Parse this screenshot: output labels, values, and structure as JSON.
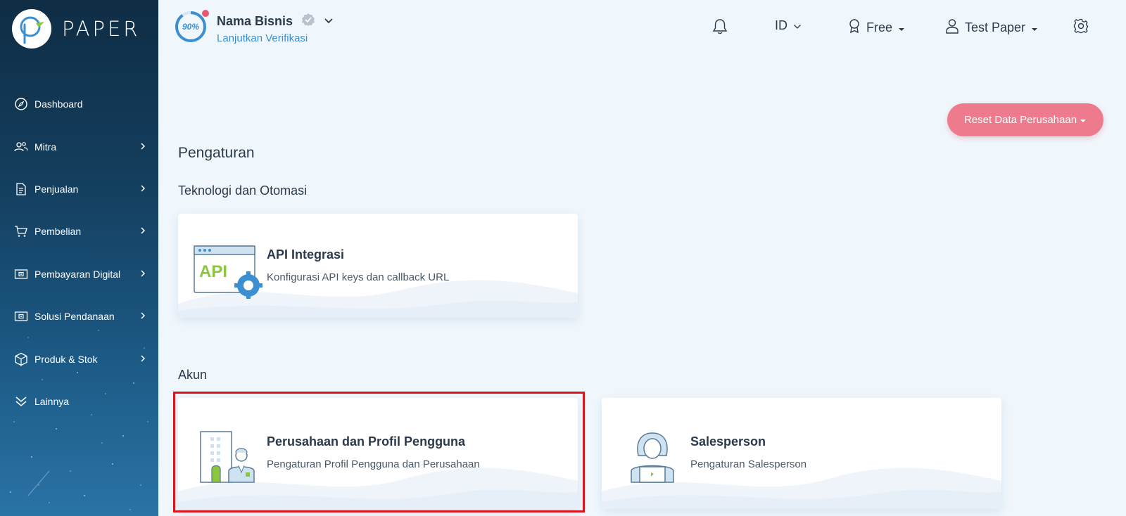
{
  "app": {
    "logo_text": "PAPER"
  },
  "sidebar": {
    "items": [
      {
        "label": "Dashboard",
        "icon": "compass-icon",
        "has_submenu": false
      },
      {
        "label": "Mitra",
        "icon": "users-icon",
        "has_submenu": true
      },
      {
        "label": "Penjualan",
        "icon": "document-icon",
        "has_submenu": true
      },
      {
        "label": "Pembelian",
        "icon": "cart-icon",
        "has_submenu": true
      },
      {
        "label": "Pembayaran Digital",
        "icon": "wallet-icon",
        "has_submenu": true
      },
      {
        "label": "Solusi Pendanaan",
        "icon": "wallet-icon",
        "has_submenu": true
      },
      {
        "label": "Produk & Stok",
        "icon": "box-icon",
        "has_submenu": true
      },
      {
        "label": "Lainnya",
        "icon": "double-chevron-down-icon",
        "has_submenu": false
      }
    ]
  },
  "header": {
    "progress": "90%",
    "progress_value": 0.9,
    "business_name": "Nama Bisnis",
    "verify_link": "Lanjutkan Verifikasi",
    "language": "ID",
    "plan": "Free",
    "user": "Test Paper"
  },
  "main": {
    "reset_button": "Reset Data Perusahaan",
    "page_title": "Pengaturan",
    "sections": [
      {
        "title": "Teknologi dan Otomasi",
        "cards": [
          {
            "title": "API Integrasi",
            "subtitle": "Konfigurasi API keys dan callback URL",
            "icon_text": "API"
          }
        ]
      },
      {
        "title": "Akun",
        "cards": [
          {
            "title": "Perusahaan dan Profil Pengguna",
            "subtitle": "Pengaturan Profil Pengguna dan Perusahaan"
          },
          {
            "title": "Salesperson",
            "subtitle": "Pengaturan Salesperson"
          }
        ]
      }
    ]
  },
  "colors": {
    "accent_blue": "#3b8fd0",
    "reset_button": "#ee7b8d",
    "sidebar_top": "#0f2d45",
    "sidebar_bottom": "#2a73a6",
    "highlight_border": "#d9161c",
    "api_green": "#8cc63f"
  }
}
